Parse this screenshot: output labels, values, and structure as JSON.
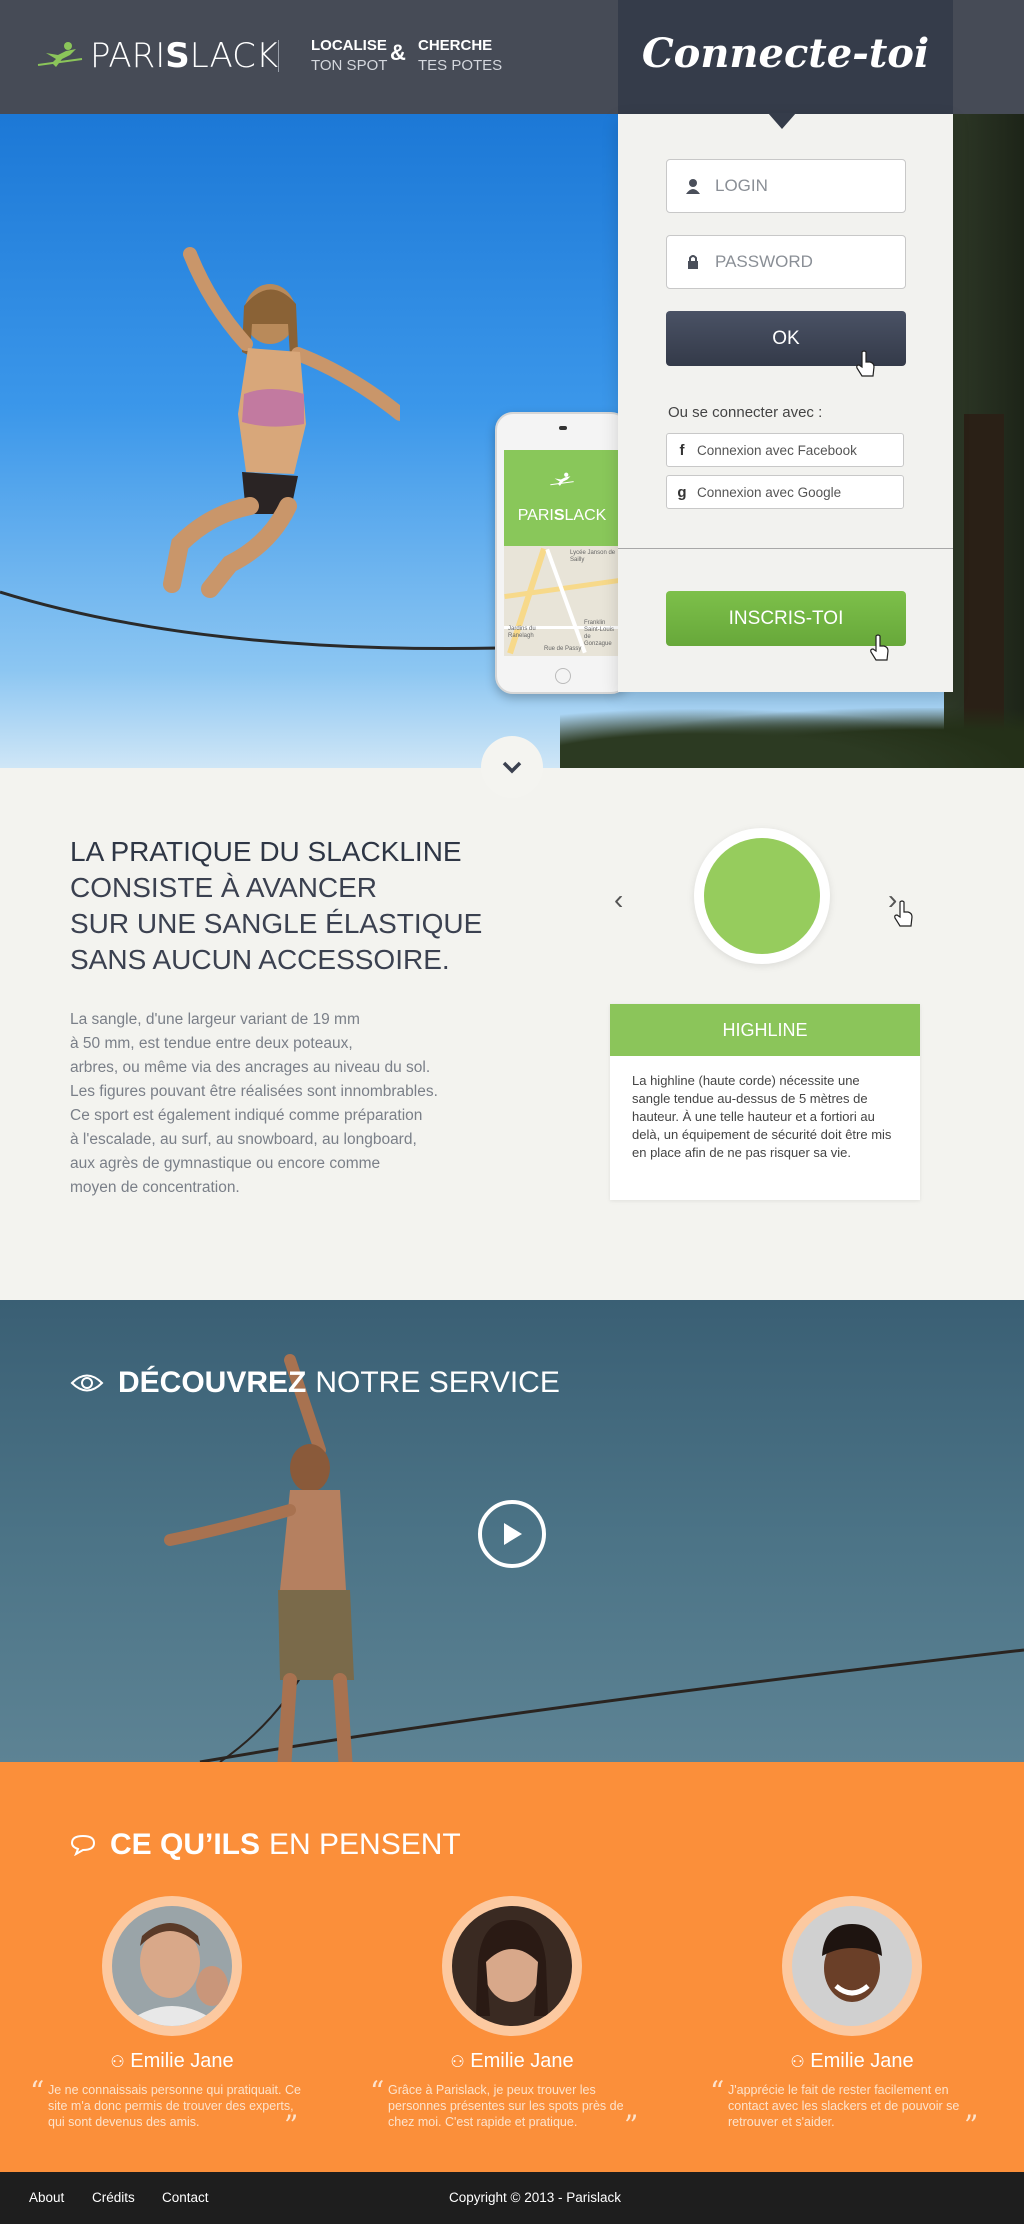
{
  "header": {
    "logo_pre": "PARI",
    "logo_bold": "S",
    "logo_post": "LACK",
    "tag_left_1": "LOCALISE",
    "tag_left_2": "TON SPOT",
    "tag_amp": "&",
    "tag_right_1": "CHERCHE",
    "tag_right_2": "TES POTES"
  },
  "login": {
    "title": "Connecte-toi",
    "login_placeholder": "LOGIN",
    "password_placeholder": "PASSWORD",
    "ok_label": "OK",
    "or_text": "Ou se connecter avec :",
    "facebook_icon": "f",
    "facebook_label": "Connexion avec Facebook",
    "google_icon": "g",
    "google_label": "Connexion avec Google",
    "signup_label": "INSCRIS-TOI"
  },
  "phone": {
    "brand_pre": "PARI",
    "brand_bold": "S",
    "brand_post": "LACK",
    "map_labels": [
      "Lycée Janson de Sailly",
      "Jardins du Ranelagh",
      "Franklin Saint-Louis de Gonzague",
      "Rue de Passy"
    ]
  },
  "slackline": {
    "title_line_1": "LA PRATIQUE DU SLACKLINE",
    "title_line_2": "CONSISTE À AVANCER",
    "title_line_3": "SUR UNE SANGLE ÉLASTIQUE",
    "title_line_4": "SANS AUCUN ACCESSOIRE.",
    "body": [
      "La sangle, d'une largeur variant de 19 mm",
      "à 50 mm, est tendue entre deux poteaux,",
      "arbres, ou même via des ancrages au niveau du sol.",
      "Les figures pouvant être réalisées sont innombrables.",
      "Ce sport est également indiqué comme préparation",
      "à l'escalade, au surf, au snowboard, au longboard,",
      "aux agrès de gymnastique ou encore comme",
      "moyen de concentration."
    ],
    "prev_icon": "‹",
    "next_icon": "›",
    "card_title": "HIGHLINE",
    "card_text": "La highline (haute corde) nécessite une sangle tendue au-dessus de 5 mètres de hauteur. À une telle hauteur et a fortiori au delà, un équipement de sécurité doit être mis en place afin de ne pas risquer sa vie."
  },
  "video": {
    "title_bold": "DÉCOUVREZ",
    "title_rest": "NOTRE SERVICE"
  },
  "testimonials": {
    "title_bold": "CE QU’ILS",
    "title_rest": "EN PENSENT",
    "items": [
      {
        "name": "Emilie Jane",
        "quote": "Je ne connaissais personne qui pratiquait. Ce site m'a donc permis de trouver des experts, qui sont devenus des amis."
      },
      {
        "name": "Emilie Jane",
        "quote": "Grâce à Parislack, je peux trouver les personnes présentes sur les spots près de chez moi. C'est rapide et pratique."
      },
      {
        "name": "Emilie Jane",
        "quote": "J'apprécie le fait de rester facilement en contact avec les slackers et de pouvoir se retrouver et s'aider."
      }
    ],
    "open_quote": "“",
    "close_quote": "”"
  },
  "footer": {
    "links": [
      "About",
      "Crédits",
      "Contact"
    ],
    "copyright": "Copyright  © 2013 - Parislack"
  },
  "colors": {
    "header_bg": "#464b56",
    "login_head": "#353c4a",
    "green": "#8bc55a",
    "orange": "#fb8f3a",
    "footer": "#1e1e1e"
  }
}
